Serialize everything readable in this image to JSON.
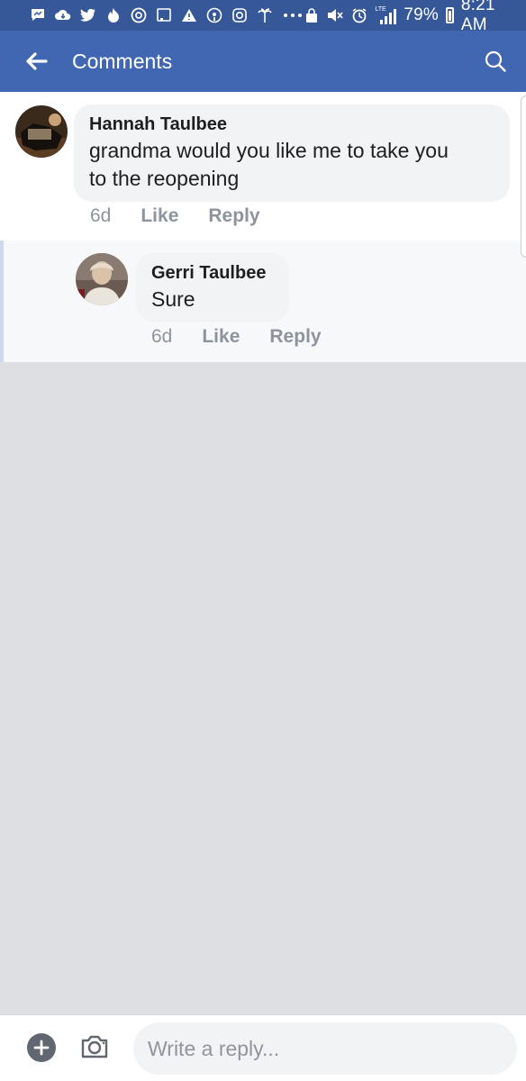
{
  "status_bar": {
    "icons_left": [
      "messenger-icon",
      "cloud-download-icon",
      "twitter-icon",
      "tinder-icon",
      "sync-icon",
      "cast-icon",
      "alert-icon",
      "podcast-icon",
      "instagram-icon",
      "palm-tree-icon",
      "more-dots-icon"
    ],
    "icons_right": [
      "lock-icon",
      "mute-icon",
      "alarm-icon",
      "lte-signal-icon",
      "battery-icon"
    ],
    "battery": "79%",
    "time": "8:21 AM",
    "network": "LTE"
  },
  "header": {
    "title": "Comments",
    "back_icon": "back-arrow-icon",
    "search_icon": "search-icon",
    "background": "#4267b2"
  },
  "comments": [
    {
      "author": "Hannah Taulbee",
      "text_line1": "grandma would you like me to take you",
      "text_line2": "to the reopening",
      "time": "6d",
      "like": "Like",
      "reply": "Reply"
    }
  ],
  "replies": [
    {
      "author": "Gerri Taulbee",
      "text": "Sure",
      "time": "6d",
      "like": "Like",
      "reply": "Reply"
    }
  ],
  "composer": {
    "placeholder": "Write a reply...",
    "add_icon": "plus-icon",
    "camera_icon": "camera-icon"
  }
}
